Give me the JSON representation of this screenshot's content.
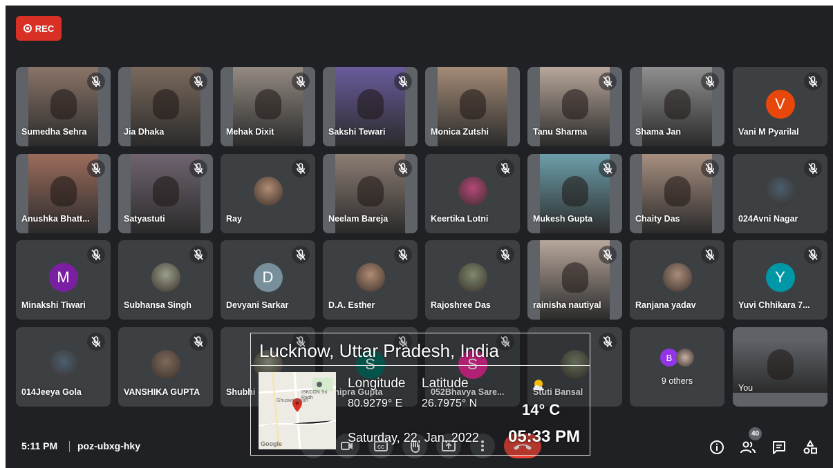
{
  "recording": {
    "label": "REC"
  },
  "meeting": {
    "time": "5:11 PM",
    "code": "poz-ubxg-hky",
    "participant_count": "40"
  },
  "participants": [
    {
      "name": "Sumedha Sehra",
      "type": "video"
    },
    {
      "name": "Jia Dhaka",
      "type": "video"
    },
    {
      "name": "Mehak Dixit",
      "type": "video"
    },
    {
      "name": "Sakshi Tewari",
      "type": "video"
    },
    {
      "name": "Monica Zutshi",
      "type": "video"
    },
    {
      "name": "Tanu Sharma",
      "type": "video"
    },
    {
      "name": "Shama Jan",
      "type": "video"
    },
    {
      "name": "Vani M Pyarilal",
      "type": "letter",
      "letter": "V",
      "color": "#e8470b"
    },
    {
      "name": "Anushka Bhatt...",
      "type": "video"
    },
    {
      "name": "Satyastuti",
      "type": "video"
    },
    {
      "name": "Ray",
      "type": "photo"
    },
    {
      "name": "Neelam Bareja",
      "type": "video"
    },
    {
      "name": "Keertika Lotni",
      "type": "photo"
    },
    {
      "name": "Mukesh Gupta",
      "type": "video"
    },
    {
      "name": "Chaity Das",
      "type": "video"
    },
    {
      "name": "024Avni Nagar",
      "type": "photo"
    },
    {
      "name": "Minakshi Tiwari",
      "type": "letter",
      "letter": "M",
      "color": "#7b1fa2"
    },
    {
      "name": "Subhansa Singh",
      "type": "photo"
    },
    {
      "name": "Devyani Sarkar",
      "type": "letter",
      "letter": "D",
      "color": "#78909c"
    },
    {
      "name": "D.A. Esther",
      "type": "photo"
    },
    {
      "name": "Rajoshree Das",
      "type": "photo"
    },
    {
      "name": "rainisha nautiyal",
      "type": "video"
    },
    {
      "name": "Ranjana yadav",
      "type": "photo"
    },
    {
      "name": "Yuvi Chhikara 7...",
      "type": "letter",
      "letter": "Y",
      "color": "#0097a7"
    },
    {
      "name": "014Jeeya Gola",
      "type": "photo"
    },
    {
      "name": "VANSHIKA GUPTA",
      "type": "photo"
    },
    {
      "name": "Shubhi",
      "type": "photo"
    },
    {
      "name": "Shipra Gupta",
      "type": "letter",
      "letter": "S",
      "color": "#00695c"
    },
    {
      "name": "052Bhavya Sare...",
      "type": "letter",
      "letter": "S",
      "color": "#e52592"
    },
    {
      "name": "Stuti Bansal",
      "type": "photo"
    },
    {
      "name": "9 others",
      "type": "others",
      "letter": "B",
      "color": "#9334e6"
    },
    {
      "name": "You",
      "type": "video"
    }
  ],
  "geo_overlay": {
    "location": "Lucknow, Uttar Pradesh, India",
    "longitude_label": "Longitude",
    "latitude_label": "Latitude",
    "longitude": "80.9279° E",
    "latitude": "26.7975° N",
    "temperature": "14° C",
    "date": "Saturday, 22, Jan, 2022",
    "clock": "05:33 PM",
    "map_labels": {
      "temple": "ISKCON Sri Radh",
      "area": "Ghuswa Kalan",
      "brand": "Google"
    }
  },
  "colors": {
    "background": "#202124",
    "tile": "#3c4043",
    "rec": "#d93025",
    "end_call": "#ea4335"
  }
}
